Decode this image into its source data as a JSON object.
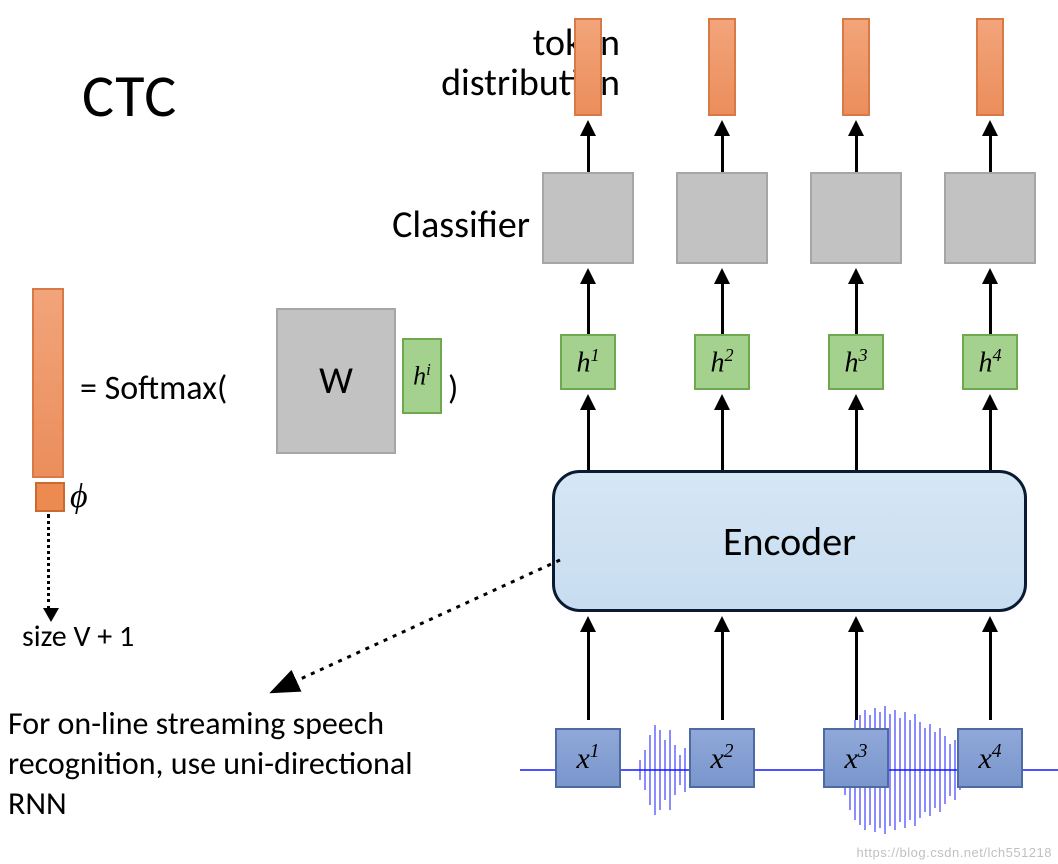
{
  "title": "CTC",
  "token_label_line1": "token",
  "token_label_line2": "distribution",
  "classifier_label": "Classifier",
  "softmax_prefix": "= Softmax(",
  "softmax_suffix": " )",
  "W_label": "W",
  "h_i_label_base": "h",
  "h_i_label_sup": "i",
  "phi_label": "ϕ",
  "size_label": "size V + 1",
  "note_line1": "For on-line streaming speech",
  "note_line2": "recognition, use uni-directional",
  "note_line3": "RNN",
  "encoder_label": "Encoder",
  "h_labels": [
    "h",
    "h",
    "h",
    "h"
  ],
  "h_sups": [
    "1",
    "2",
    "3",
    "4"
  ],
  "x_labels": [
    "x",
    "x",
    "x",
    "x"
  ],
  "x_sups": [
    "1",
    "2",
    "3",
    "4"
  ],
  "watermark": "https://blog.csdn.net/lch551218",
  "colors": {
    "orange": "#ec8a4f",
    "green": "#a4d18d",
    "grey": "#c2c2c2",
    "blue_fill": "#c7ddf0",
    "x_blue": "#7a96cc",
    "wave_blue": "#1418ff"
  }
}
